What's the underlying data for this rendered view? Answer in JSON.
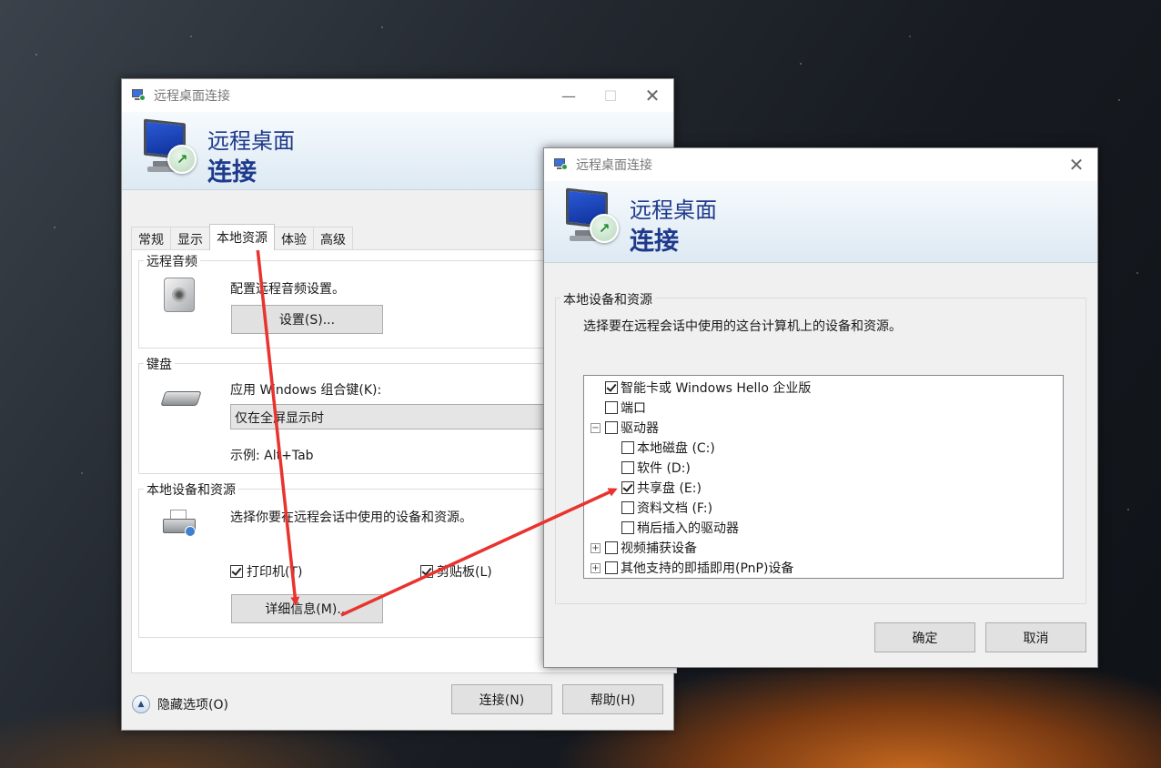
{
  "main_window": {
    "title": "远程桌面连接",
    "banner_line1": "远程桌面",
    "banner_line2": "连接",
    "tabs": [
      {
        "label": "常规"
      },
      {
        "label": "显示"
      },
      {
        "label": "本地资源"
      },
      {
        "label": "体验"
      },
      {
        "label": "高级"
      }
    ],
    "active_tab": "本地资源",
    "audio_group": {
      "label": "远程音频",
      "desc": "配置远程音频设置。",
      "button": "设置(S)..."
    },
    "keyboard_group": {
      "label": "键盘",
      "desc": "应用 Windows 组合键(K):",
      "select_value": "仅在全屏显示时",
      "example": "示例: Alt+Tab"
    },
    "local_group": {
      "label": "本地设备和资源",
      "desc": "选择你要在远程会话中使用的设备和资源。",
      "printer_label": "打印机(T)",
      "printer_checked": true,
      "clipboard_label": "剪贴板(L)",
      "clipboard_checked": true,
      "details_button": "详细信息(M)..."
    },
    "hide_options": "隐藏选项(O)",
    "connect_button": "连接(N)",
    "help_button": "帮助(H)",
    "close_icon": "close-icon",
    "minimize_icon": "minimize-icon",
    "maximize_icon": "maximize-icon"
  },
  "dialog": {
    "title": "远程桌面连接",
    "banner_line1": "远程桌面",
    "banner_line2": "连接",
    "group_label": "本地设备和资源",
    "desc": "选择要在远程会话中使用的这台计算机上的设备和资源。",
    "tree": [
      {
        "label": "智能卡或 Windows Hello 企业版",
        "checked": true,
        "level": 0,
        "expander": ""
      },
      {
        "label": "端口",
        "checked": false,
        "level": 0,
        "expander": ""
      },
      {
        "label": "驱动器",
        "checked": false,
        "level": 0,
        "expander": "−"
      },
      {
        "label": "本地磁盘 (C:)",
        "checked": false,
        "level": 1,
        "expander": ""
      },
      {
        "label": "软件 (D:)",
        "checked": false,
        "level": 1,
        "expander": ""
      },
      {
        "label": "共享盘 (E:)",
        "checked": true,
        "level": 1,
        "expander": ""
      },
      {
        "label": "资料文档 (F:)",
        "checked": false,
        "level": 1,
        "expander": ""
      },
      {
        "label": "稍后插入的驱动器",
        "checked": false,
        "level": 1,
        "expander": ""
      },
      {
        "label": "视频捕获设备",
        "checked": false,
        "level": 0,
        "expander": "+"
      },
      {
        "label": "其他支持的即插即用(PnP)设备",
        "checked": false,
        "level": 0,
        "expander": "+"
      }
    ],
    "ok_button": "确定",
    "cancel_button": "取消"
  },
  "colors": {
    "banner_text": "#1e3a8c",
    "arrow": "#e8332e"
  }
}
